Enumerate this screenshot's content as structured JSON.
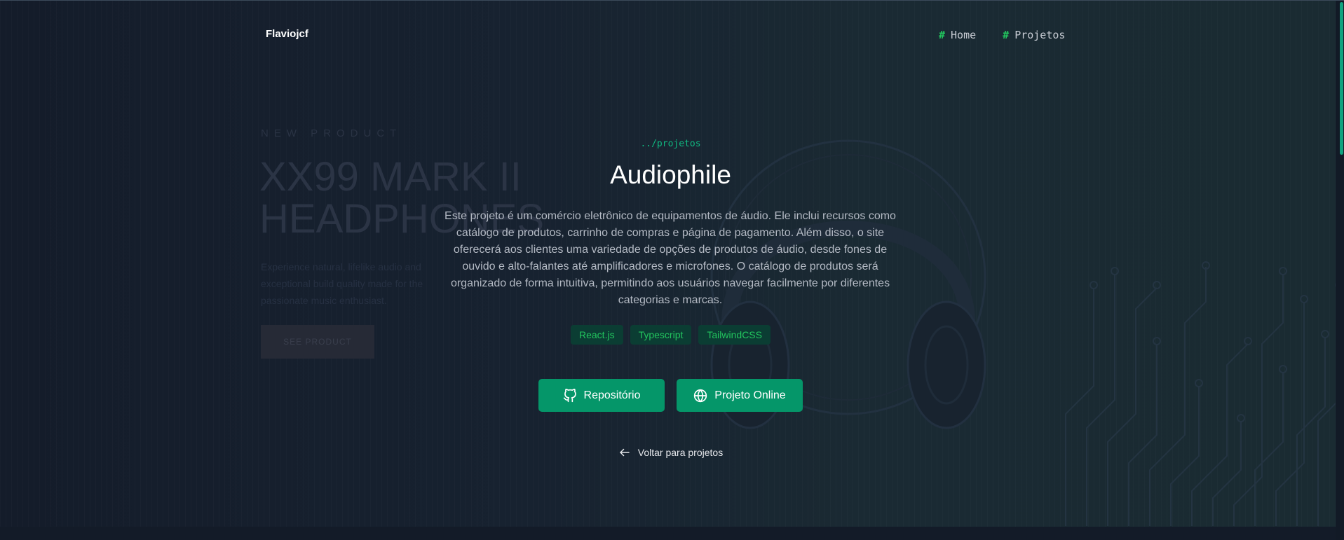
{
  "header": {
    "logo": "Flaviojcf",
    "nav": [
      {
        "hash": "#",
        "label": "Home"
      },
      {
        "hash": "#",
        "label": "Projetos"
      }
    ]
  },
  "background_preview": {
    "eyebrow": "NEW PRODUCT",
    "title_line1": "XX99 MARK II",
    "title_line2": "HEADPHONES",
    "paragraph": "Experience natural, lifelike audio and exceptional build quality made for the passionate music enthusiast.",
    "button": "SEE PRODUCT"
  },
  "project": {
    "breadcrumb": "../projetos",
    "title": "Audiophile",
    "description": "Este projeto é um comércio eletrônico de equipamentos de áudio. Ele inclui recursos como catálogo de produtos, carrinho de compras e página de pagamento. Além disso, o site oferecerá aos clientes uma variedade de opções de produtos de áudio, desde fones de ouvido e alto-falantes até amplificadores e microfones. O catálogo de produtos será organizado de forma intuitiva, permitindo aos usuários navegar facilmente por diferentes categorias e marcas.",
    "tags": [
      "React.js",
      "Typescript",
      "TailwindCSS"
    ],
    "repo_button": "Repositório",
    "online_button": "Projeto Online",
    "back_link": "Voltar para projetos"
  },
  "icons": {
    "repo": "github-icon",
    "online": "globe-icon",
    "back": "arrow-left-icon"
  },
  "colors": {
    "accent": "#059669",
    "accent_text": "#22c55e",
    "background": "#111827"
  }
}
